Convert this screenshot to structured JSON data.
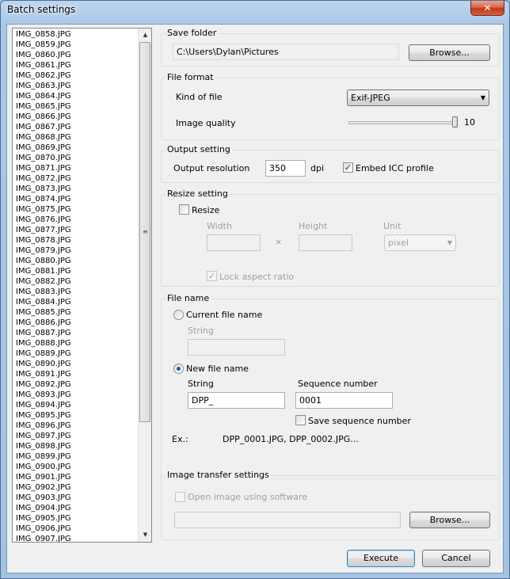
{
  "window": {
    "title": "Batch settings",
    "close_glyph": "✕"
  },
  "file_list": {
    "items": [
      "IMG_0858.JPG",
      "IMG_0859.JPG",
      "IMG_0860.JPG",
      "IMG_0861.JPG",
      "IMG_0862.JPG",
      "IMG_0863.JPG",
      "IMG_0864.JPG",
      "IMG_0865.JPG",
      "IMG_0866.JPG",
      "IMG_0867.JPG",
      "IMG_0868.JPG",
      "IMG_0869.JPG",
      "IMG_0870.JPG",
      "IMG_0871.JPG",
      "IMG_0872.JPG",
      "IMG_0873.JPG",
      "IMG_0874.JPG",
      "IMG_0875.JPG",
      "IMG_0876.JPG",
      "IMG_0877.JPG",
      "IMG_0878.JPG",
      "IMG_0879.JPG",
      "IMG_0880.JPG",
      "IMG_0881.JPG",
      "IMG_0882.JPG",
      "IMG_0883.JPG",
      "IMG_0884.JPG",
      "IMG_0885.JPG",
      "IMG_0886.JPG",
      "IMG_0887.JPG",
      "IMG_0888.JPG",
      "IMG_0889.JPG",
      "IMG_0890.JPG",
      "IMG_0891.JPG",
      "IMG_0892.JPG",
      "IMG_0893.JPG",
      "IMG_0894.JPG",
      "IMG_0895.JPG",
      "IMG_0896.JPG",
      "IMG_0897.JPG",
      "IMG_0898.JPG",
      "IMG_0899.JPG",
      "IMG_0900.JPG",
      "IMG_0901.JPG",
      "IMG_0902.JPG",
      "IMG_0903.JPG",
      "IMG_0904.JPG",
      "IMG_0905.JPG",
      "IMG_0906.JPG",
      "IMG_0907.JPG"
    ],
    "scroll_up_glyph": "▲",
    "scroll_down_glyph": "▼",
    "scroll_grip_glyph": "≡"
  },
  "save_folder": {
    "title": "Save folder",
    "path": "C:\\Users\\Dylan\\Pictures",
    "browse_label": "Browse..."
  },
  "file_format": {
    "title": "File format",
    "kind_label": "Kind of file",
    "kind_value": "Exif-JPEG",
    "quality_label": "Image quality",
    "quality_value": "10",
    "quality_fraction": 1.0
  },
  "output_setting": {
    "title": "Output setting",
    "resolution_label": "Output resolution",
    "resolution_value": "350",
    "resolution_unit": "dpi",
    "embed_icc_label": "Embed ICC profile",
    "embed_icc_checked": true
  },
  "resize_setting": {
    "title": "Resize setting",
    "resize_label": "Resize",
    "resize_checked": false,
    "width_label": "Width",
    "height_label": "Height",
    "unit_label": "Unit",
    "times_glyph": "×",
    "unit_value": "pixel",
    "lock_label": "Lock aspect ratio",
    "lock_checked": true
  },
  "file_name": {
    "title": "File name",
    "current_label": "Current file name",
    "current_string_label": "String",
    "new_label": "New file name",
    "new_string_label": "String",
    "new_string_value": "DPP_",
    "sequence_label": "Sequence number",
    "sequence_value": "0001",
    "save_sequence_label": "Save sequence number",
    "example_label": "Ex.:",
    "example_value": "DPP_0001.JPG, DPP_0002.JPG..."
  },
  "transfer": {
    "title": "Image transfer settings",
    "open_label": "Open image using software",
    "browse_label": "Browse..."
  },
  "footer": {
    "execute_label": "Execute",
    "cancel_label": "Cancel"
  },
  "colors": {
    "window_frame": "#a3c3e5",
    "dialog_bg": "#f0f0f0",
    "close_button": "#c3381c"
  }
}
